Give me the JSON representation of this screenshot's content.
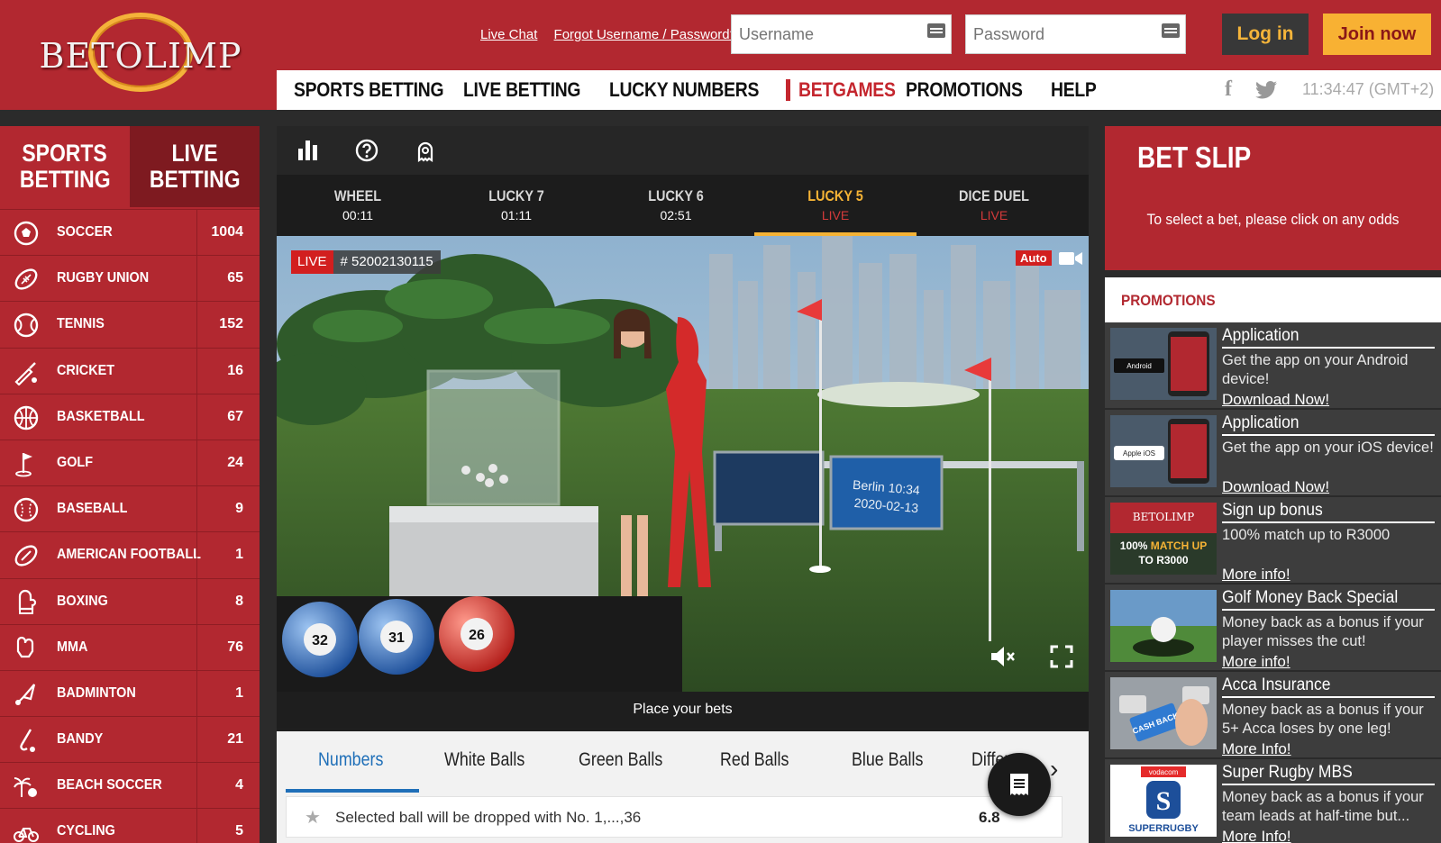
{
  "brand": {
    "name": "BETOLIMP"
  },
  "header": {
    "live_chat": "Live Chat",
    "forgot": "Forgot Username / Password?",
    "username_placeholder": "Username",
    "password_placeholder": "Password",
    "login_label": "Log in",
    "join_label": "Join now",
    "clock": "11:34:47 (GMT+2)"
  },
  "nav": {
    "items": [
      "SPORTS BETTING",
      "LIVE BETTING",
      "LUCKY NUMBERS",
      "BETGAMES",
      "PROMOTIONS",
      "HELP"
    ],
    "active": "BETGAMES"
  },
  "sidebar": {
    "tab_sports": [
      "SPORTS",
      "BETTING"
    ],
    "tab_live": [
      "LIVE",
      "BETTING"
    ],
    "sports": [
      {
        "name": "SOCCER",
        "count": "1004",
        "icon": "soccer-ball-icon"
      },
      {
        "name": "RUGBY UNION",
        "count": "65",
        "icon": "rugby-ball-icon"
      },
      {
        "name": "TENNIS",
        "count": "152",
        "icon": "tennis-ball-icon"
      },
      {
        "name": "CRICKET",
        "count": "16",
        "icon": "cricket-bat-icon"
      },
      {
        "name": "BASKETBALL",
        "count": "67",
        "icon": "basketball-icon"
      },
      {
        "name": "GOLF",
        "count": "24",
        "icon": "golf-icon"
      },
      {
        "name": "BASEBALL",
        "count": "9",
        "icon": "baseball-icon"
      },
      {
        "name": "AMERICAN FOOTBALL",
        "count": "1",
        "icon": "american-football-icon"
      },
      {
        "name": "BOXING",
        "count": "8",
        "icon": "boxing-glove-icon"
      },
      {
        "name": "MMA",
        "count": "76",
        "icon": "mma-glove-icon"
      },
      {
        "name": "BADMINTON",
        "count": "1",
        "icon": "shuttlecock-icon"
      },
      {
        "name": "BANDY",
        "count": "21",
        "icon": "bandy-stick-icon"
      },
      {
        "name": "BEACH SOCCER",
        "count": "4",
        "icon": "beach-soccer-icon"
      },
      {
        "name": "CYCLING",
        "count": "5",
        "icon": "bicycle-icon"
      }
    ]
  },
  "games": {
    "tabs": [
      {
        "name": "WHEEL",
        "time": "00:11"
      },
      {
        "name": "LUCKY 7",
        "time": "01:11"
      },
      {
        "name": "LUCKY 6",
        "time": "02:51"
      },
      {
        "name": "LUCKY 5",
        "time": "LIVE"
      },
      {
        "name": "DICE DUEL",
        "time": "LIVE"
      }
    ],
    "active": "LUCKY 5"
  },
  "video": {
    "live_label": "LIVE",
    "draw_id": "# 52002130115",
    "auto_label": "Auto",
    "screen_text_1": "Berlin 10:34",
    "screen_text_2": "2020-02-13",
    "balls": [
      "32",
      "31",
      "26"
    ]
  },
  "place_bets": "Place your bets",
  "bet_tabs": {
    "items": [
      "Numbers",
      "White Balls",
      "Green Balls",
      "Red Balls",
      "Blue Balls",
      "Differer"
    ],
    "active": "Numbers"
  },
  "bet_row": {
    "desc": "Selected ball will be dropped with No. 1,...,36",
    "odds": "6.8"
  },
  "betslip": {
    "title": "BET SLIP",
    "message": "To select a bet, please click on any odds"
  },
  "promotions": {
    "title": "PROMOTIONS",
    "items": [
      {
        "title": "Application",
        "desc": "Get the app on your Android device!",
        "link": "Download Now!",
        "thumb": "android"
      },
      {
        "title": "Application",
        "desc": "Get the app on your iOS device!",
        "link": "Download Now!",
        "thumb": "ios"
      },
      {
        "title": "Sign up bonus",
        "desc": "100% match up to R3000",
        "link": "More info!",
        "thumb": "signup"
      },
      {
        "title": "Golf Money Back Special",
        "desc": "Money back as a bonus if your player misses the cut!",
        "link": "More info!",
        "thumb": "golf"
      },
      {
        "title": "Acca Insurance",
        "desc": "Money back as a bonus if your 5+ Acca loses by one leg!",
        "link": "More Info!",
        "thumb": "acca"
      },
      {
        "title": "Super Rugby MBS",
        "desc": "Money back as a bonus if your team leads at half-time but...",
        "link": "More Info!",
        "thumb": "rugby"
      }
    ],
    "thumb_text": {
      "android": "Android",
      "ios": "Apple iOS",
      "signup_logo": "BETOLIMP",
      "signup_l1a": "100% ",
      "signup_l1b": "MATCH UP",
      "signup_l2": "TO R3000",
      "acca": "CASH BACK",
      "vodacom": "vodacom",
      "super_rugby": "SUPERRUGBY"
    }
  },
  "colors": {
    "brand_red": "#b22830",
    "accent_gold": "#f5b335",
    "link_blue": "#1f6fb8"
  }
}
